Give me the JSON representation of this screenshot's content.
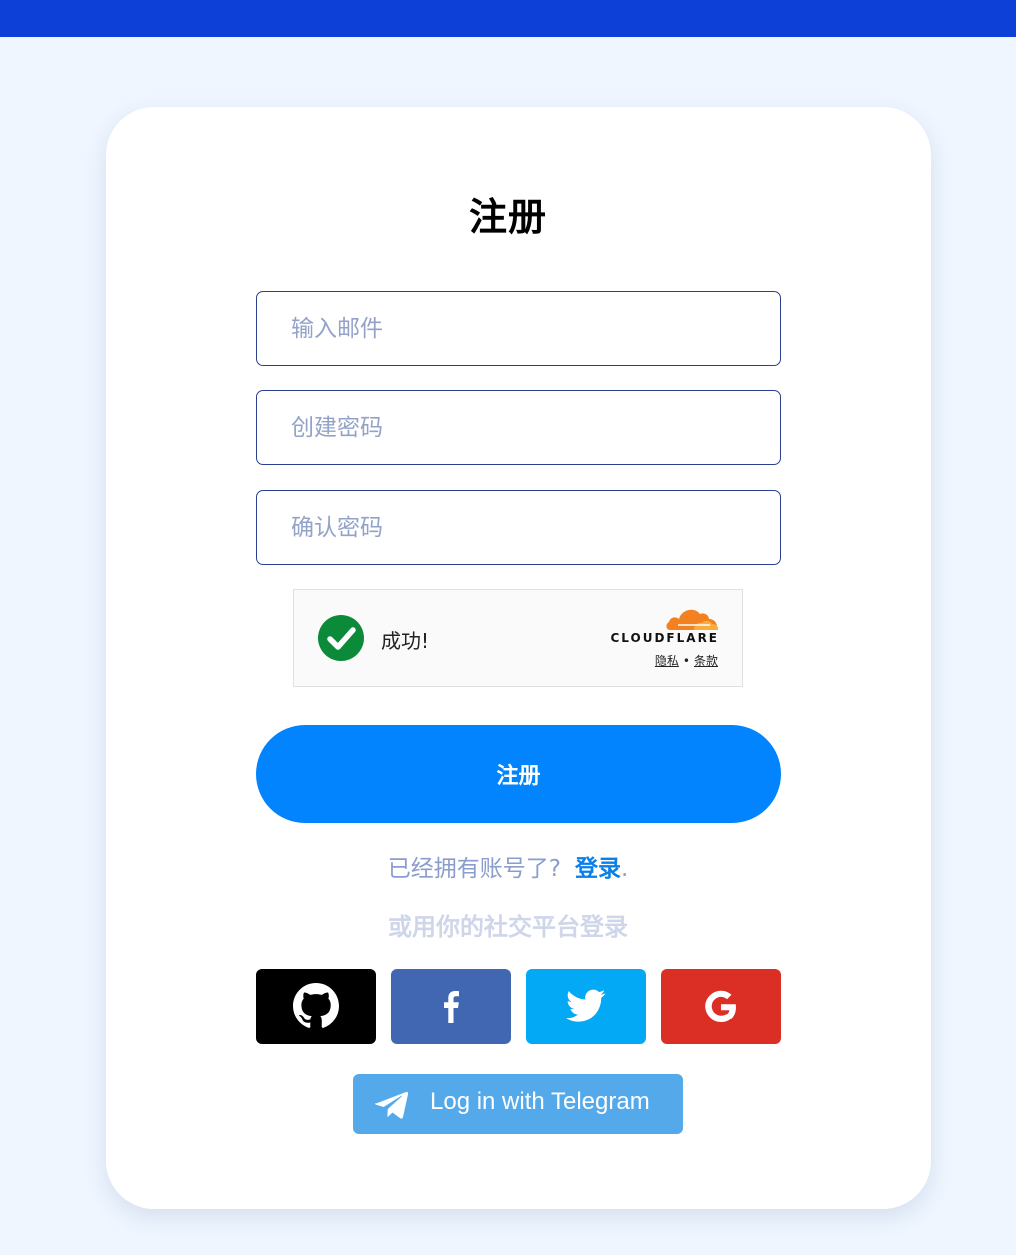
{
  "header": {
    "bar_color": "#0c40d6"
  },
  "form": {
    "title": "注册",
    "email": {
      "placeholder": "输入邮件",
      "value": ""
    },
    "password": {
      "placeholder": "创建密码",
      "value": ""
    },
    "confirm_password": {
      "placeholder": "确认密码",
      "value": ""
    },
    "captcha": {
      "status_text": "成功!",
      "icon": "check-icon",
      "brand": "CLOUDFLARE",
      "privacy_link": "隐私",
      "separator": "•",
      "terms_link": "条款"
    },
    "submit_label": "注册",
    "submit_color": "#0284fe"
  },
  "login_prompt": {
    "text": "已经拥有账号了?",
    "link": "登录",
    "suffix": "."
  },
  "social": {
    "hint": "或用你的社交平台登录",
    "buttons": [
      {
        "name": "github",
        "icon": "github-icon",
        "color": "#000000"
      },
      {
        "name": "facebook",
        "icon": "facebook-icon",
        "color": "#4267b2"
      },
      {
        "name": "twitter",
        "icon": "twitter-icon",
        "color": "#03a9f4"
      },
      {
        "name": "google",
        "icon": "google-icon",
        "color": "#db2e24"
      }
    ],
    "telegram": {
      "label": "Log in with Telegram",
      "icon": "telegram-icon",
      "color": "#54a9eb"
    }
  }
}
